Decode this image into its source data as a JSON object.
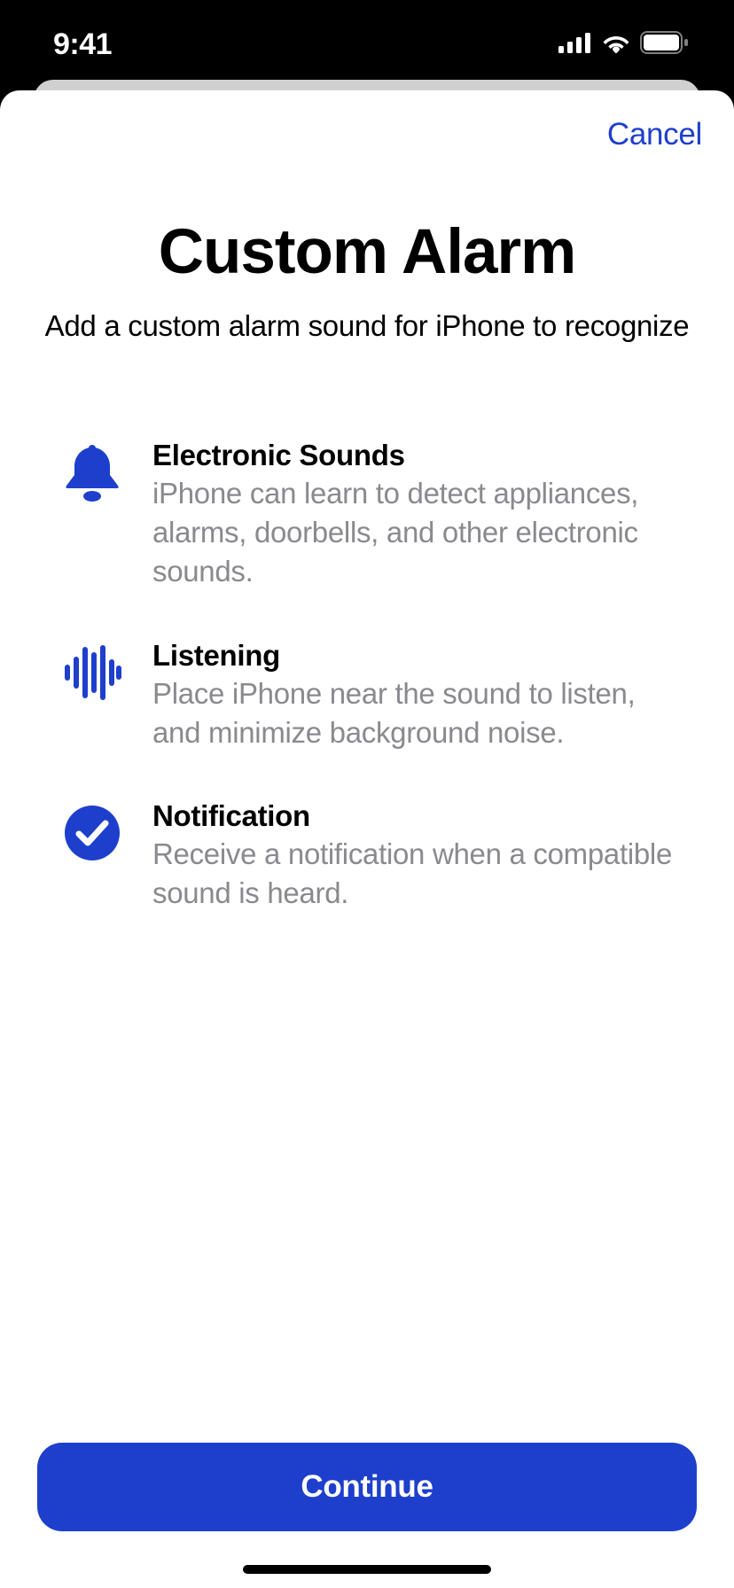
{
  "status": {
    "time": "9:41"
  },
  "nav": {
    "cancel": "Cancel"
  },
  "header": {
    "title": "Custom Alarm",
    "subtitle": "Add a custom alarm sound for iPhone to recognize"
  },
  "features": [
    {
      "icon": "bell-icon",
      "title": "Electronic Sounds",
      "desc": "iPhone can learn to detect appliances, alarms, doorbells, and other electronic sounds."
    },
    {
      "icon": "waveform-icon",
      "title": "Listening",
      "desc": "Place iPhone near the sound to listen, and minimize background noise."
    },
    {
      "icon": "checkmark-circle-icon",
      "title": "Notification",
      "desc": "Receive a notification when a compatible sound is heard."
    }
  ],
  "actions": {
    "continue": "Continue"
  },
  "colors": {
    "accent": "#1e3fcc"
  }
}
